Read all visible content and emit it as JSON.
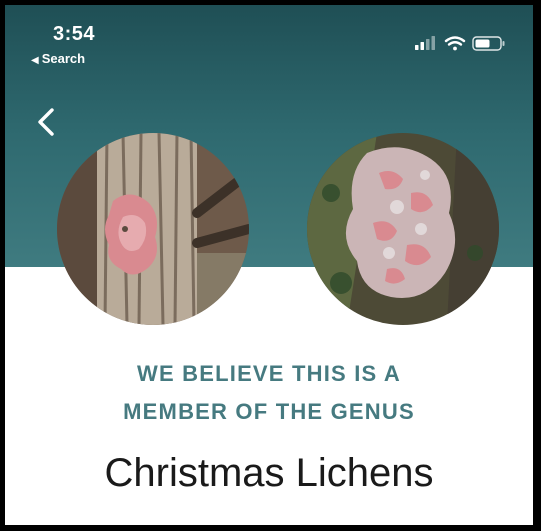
{
  "status_bar": {
    "time": "3:54",
    "back_app_label": "Search",
    "signal_icon": "cellular-signal-icon",
    "wifi_icon": "wifi-icon",
    "battery_icon": "battery-icon"
  },
  "nav": {
    "back_icon": "chevron-left-icon"
  },
  "result": {
    "kicker_line1": "WE BELIEVE THIS IS A",
    "kicker_line2": "MEMBER OF THE GENUS",
    "genus_name": "Christmas Lichens"
  },
  "colors": {
    "header_teal": "#2f6a70",
    "accent_text": "#467a80",
    "lichen_pink": "#d98a90"
  }
}
